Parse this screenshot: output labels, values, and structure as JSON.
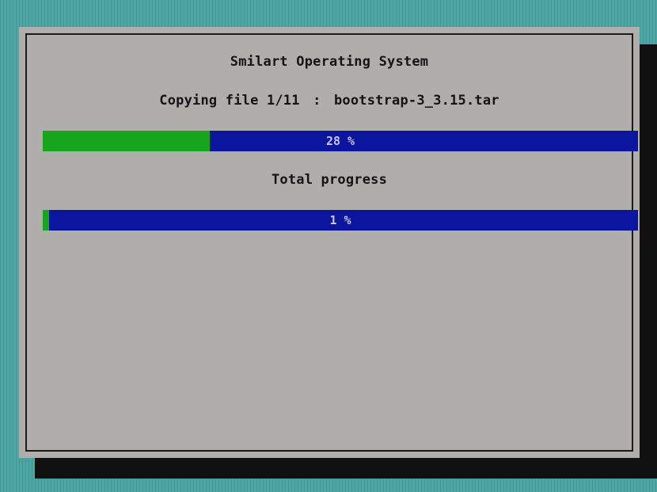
{
  "title": "Smilart Operating System",
  "copying": {
    "prefix": "Copying file",
    "counter": "1/11",
    "separator": ":",
    "filename": "bootstrap-3_3.15.tar"
  },
  "file_progress": {
    "percent": 28,
    "label": "28 %"
  },
  "total_progress": {
    "label_heading": "Total progress",
    "percent": 1,
    "label": "1 %"
  },
  "colors": {
    "background": "#4aa7a4",
    "dialog": "#b0aeab",
    "bar_track": "#0b159e",
    "bar_fill": "#16a51c",
    "bar_text": "#c8c6f0"
  }
}
